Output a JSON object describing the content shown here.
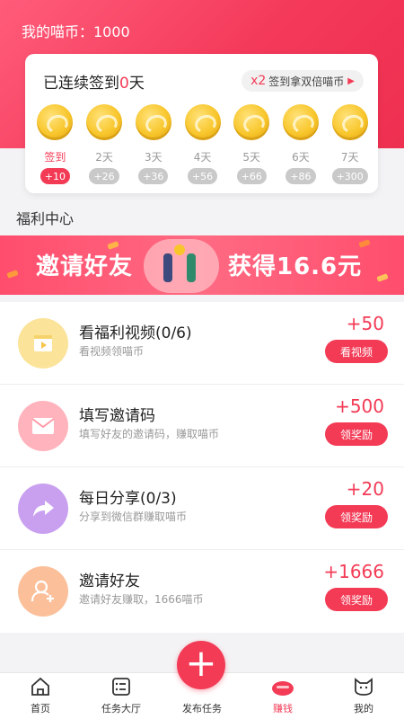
{
  "header": {
    "balance_label": "我的喵币：1000"
  },
  "signin": {
    "title_prefix": "已连续签到",
    "streak_days": "0",
    "title_suffix": "天",
    "double_badge": "x2",
    "double_text": "签到拿双倍喵币",
    "days": [
      {
        "label": "签到",
        "bonus": "+10",
        "active": true
      },
      {
        "label": "2天",
        "bonus": "+26",
        "active": false
      },
      {
        "label": "3天",
        "bonus": "+36",
        "active": false
      },
      {
        "label": "4天",
        "bonus": "+56",
        "active": false
      },
      {
        "label": "5天",
        "bonus": "+66",
        "active": false
      },
      {
        "label": "6天",
        "bonus": "+86",
        "active": false
      },
      {
        "label": "7天",
        "bonus": "+300",
        "active": false
      }
    ]
  },
  "section_title": "福利中心",
  "banner": {
    "left_text": "邀请好友",
    "right_text": "获得16.6元"
  },
  "tasks": [
    {
      "title": "看福利视频(0/6)",
      "subtitle": "看视频领喵币",
      "reward": "+50",
      "button": "看视频",
      "icon": "video-icon",
      "color": "#fbe39a"
    },
    {
      "title": "填写邀请码",
      "subtitle": "填写好友的邀请码，赚取喵币",
      "reward": "+500",
      "button": "领奖励",
      "icon": "envelope-icon",
      "color": "#ffb3bd"
    },
    {
      "title": "每日分享(0/3)",
      "subtitle": "分享到微信群赚取喵币",
      "reward": "+20",
      "button": "领奖励",
      "icon": "share-icon",
      "color": "#c9a0f0"
    },
    {
      "title": "邀请好友",
      "subtitle": "邀请好友赚取，1666喵币",
      "reward": "+1666",
      "button": "领奖励",
      "icon": "add-user-icon",
      "color": "#fbc09a"
    }
  ],
  "nav": [
    {
      "label": "首页",
      "icon": "home-icon",
      "active": false
    },
    {
      "label": "任务大厅",
      "icon": "task-hall-icon",
      "active": false
    },
    {
      "label": "发布任务",
      "icon": "plus-icon",
      "active": false
    },
    {
      "label": "赚钱",
      "icon": "earn-icon",
      "active": true
    },
    {
      "label": "我的",
      "icon": "cat-icon",
      "active": false
    }
  ],
  "colors": {
    "accent": "#f33b56",
    "coin": "#f8c62b"
  }
}
